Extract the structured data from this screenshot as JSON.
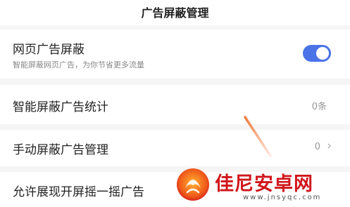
{
  "header": {
    "title": "广告屏蔽管理"
  },
  "settings": {
    "web_ads": {
      "label": "网页广告屏蔽",
      "description": "智能屏蔽网页广告，为你节省更多流量",
      "toggle_on": true
    },
    "smart_stats": {
      "label": "智能屏蔽广告统计",
      "value": "0条"
    },
    "manual": {
      "label": "手动屏蔽广告管理",
      "value": "0",
      "chevron": "›"
    },
    "shake": {
      "label": "允许展现开屏摇一摇广告"
    }
  },
  "watermark": {
    "name": "佳尼安卓网",
    "url": "www.jnsyqc.com"
  },
  "colors": {
    "accent": "#4a73e8",
    "watermark_red": "#d0151b",
    "annotation_orange": "#f07a3c"
  },
  "icons": {
    "toggle": "toggle-switch-icon",
    "chevron": "chevron-right-icon",
    "annotation": "annotation-arrow-icon",
    "logo": "site-logo-icon"
  }
}
